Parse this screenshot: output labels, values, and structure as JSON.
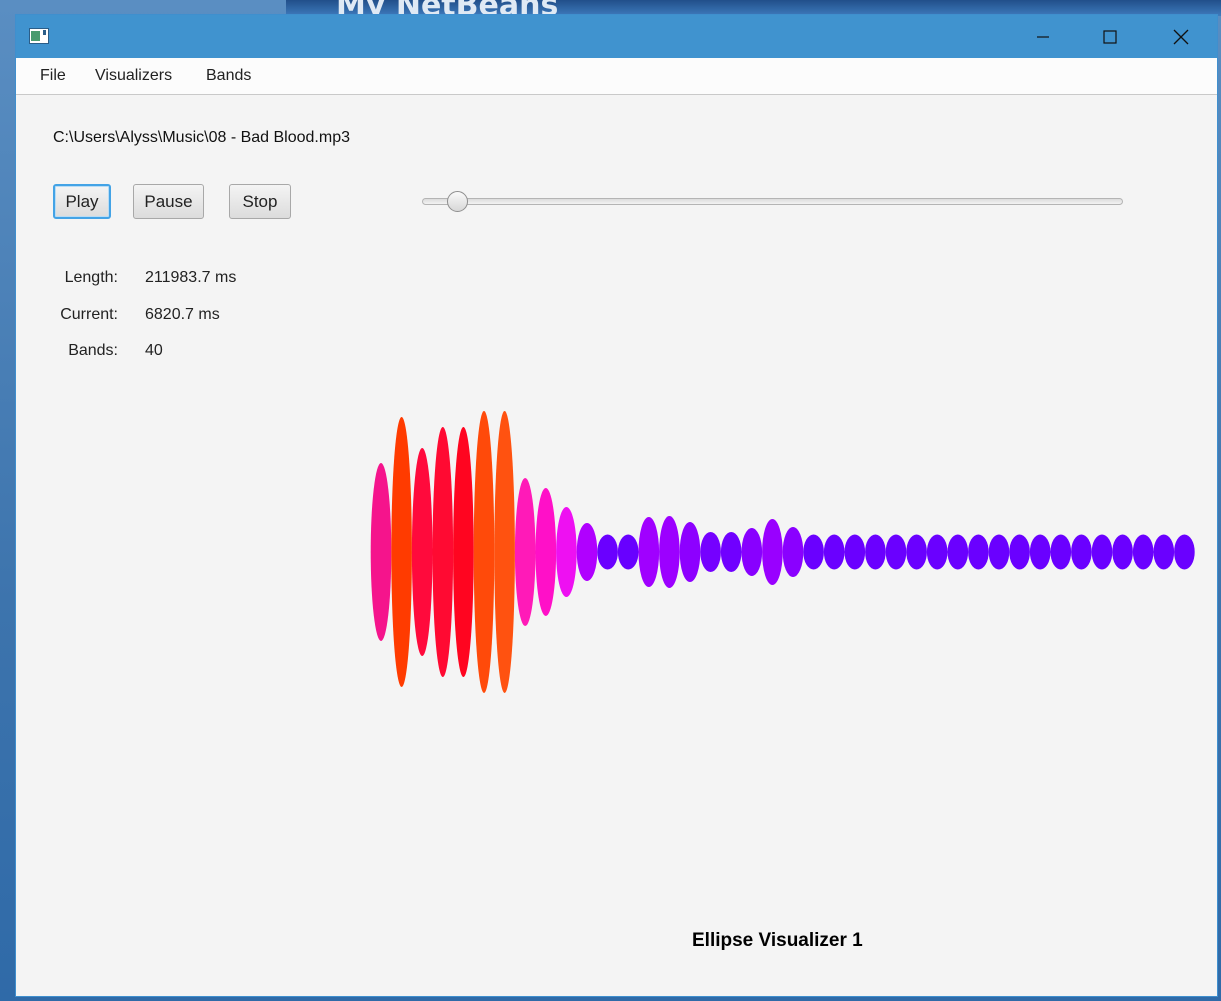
{
  "background": {
    "text": "My NetBeans"
  },
  "window": {
    "title": "",
    "icon": "java-app-icon"
  },
  "window_controls": {
    "minimize_icon": "minimize-icon",
    "maximize_icon": "maximize-icon",
    "close_icon": "close-icon"
  },
  "menu": {
    "items": [
      {
        "label": "File"
      },
      {
        "label": "Visualizers"
      },
      {
        "label": "Bands"
      }
    ]
  },
  "file_path": "C:\\Users\\Alyss\\Music\\08 - Bad Blood.mp3",
  "controls": {
    "play": "Play",
    "pause": "Pause",
    "stop": "Stop",
    "seek_position": 0.036
  },
  "info": {
    "length_label": "Length:",
    "length_value": "211983.7 ms",
    "current_label": "Current:",
    "current_value": "6820.7 ms",
    "bands_label": "Bands:",
    "bands_value": "40"
  },
  "visualizer": {
    "name": "Ellipse Visualizer 1",
    "band_count": 40,
    "colors": {
      "hot": "#ff2a00",
      "warm": "#ff5a00",
      "pink": "#ff00b0",
      "magenta": "#e600f0",
      "violet": "#8a00ff",
      "blue_violet": "#6b00ff"
    },
    "heights": [
      178,
      270,
      208,
      250,
      250,
      282,
      282,
      148,
      128,
      90,
      58,
      35,
      35,
      70,
      72,
      60,
      40,
      40,
      48,
      66,
      50,
      35,
      35,
      35,
      35,
      35,
      35,
      35,
      35,
      35,
      35,
      35,
      35,
      35,
      35,
      35,
      35,
      35,
      35,
      35
    ],
    "band_colors": [
      "#f5148c",
      "#ff3b00",
      "#ff0a3c",
      "#ff0a32",
      "#ff0520",
      "#ff4a0a",
      "#ff5210",
      "#ff1ab8",
      "#ff10c8",
      "#ee10f2",
      "#b000ff",
      "#6a00ff",
      "#6800ff",
      "#a000ff",
      "#9c00ff",
      "#8d00ff",
      "#7500ff",
      "#7000ff",
      "#8800ff",
      "#9900ff",
      "#8a00ff",
      "#6a00ff",
      "#6a00ff",
      "#6a00ff",
      "#6a00ff",
      "#6a00ff",
      "#6a00ff",
      "#6a00ff",
      "#6a00ff",
      "#6a00ff",
      "#6a00ff",
      "#6a00ff",
      "#6a00ff",
      "#6a00ff",
      "#6a00ff",
      "#6a00ff",
      "#6a00ff",
      "#6a00ff",
      "#6a00ff",
      "#6a00ff"
    ]
  }
}
